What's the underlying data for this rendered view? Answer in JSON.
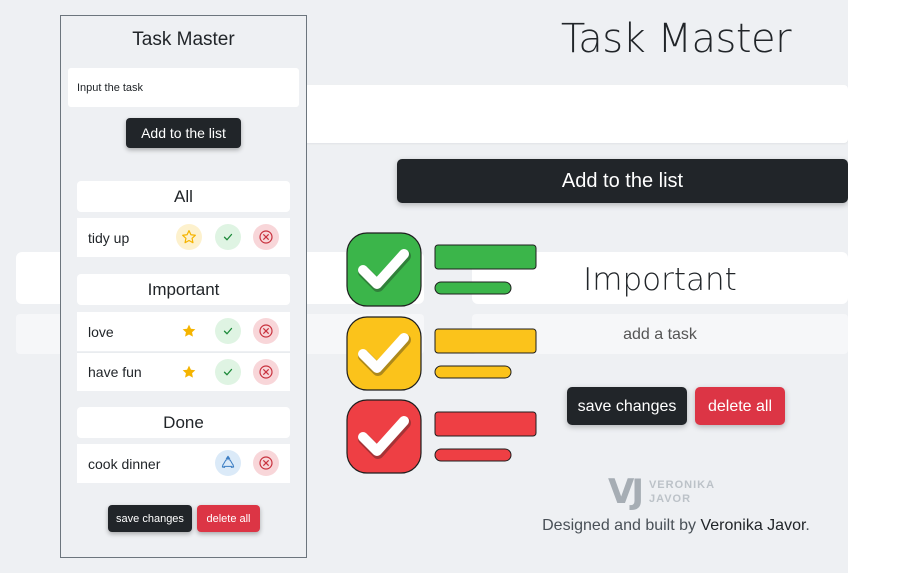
{
  "desktop": {
    "title": "Task Master",
    "add_button": "Add to the list",
    "list_heading": "Important",
    "empty_text": "add a task",
    "save_button": "save changes",
    "delete_button": "delete all",
    "logo_mark": "VJ",
    "logo_name": "VERONIKA JAVOR",
    "credit_prefix": "Designed and built by ",
    "credit_author": "Veronika Javor",
    "credit_suffix": "."
  },
  "illustration": {
    "rows": [
      {
        "color": "#3bb54a"
      },
      {
        "color": "#fbc31b"
      },
      {
        "color": "#ee3f44"
      }
    ]
  },
  "mobile": {
    "title": "Task Master",
    "input_value": "Input the task",
    "add_button": "Add to the list",
    "sections": {
      "all": {
        "heading": "All",
        "tasks": [
          {
            "label": "tidy up"
          }
        ]
      },
      "important": {
        "heading": "Important",
        "tasks": [
          {
            "label": "love"
          },
          {
            "label": "have fun"
          }
        ]
      },
      "done": {
        "heading": "Done",
        "tasks": [
          {
            "label": "cook dinner"
          }
        ]
      }
    },
    "save_button": "save changes",
    "delete_button": "delete all"
  },
  "colors": {
    "dark": "#212529",
    "danger": "#dc3545",
    "star": "#f5b400",
    "check": "#1d8a3a",
    "cross": "#c8323e",
    "recycle": "#3a7cc2"
  }
}
